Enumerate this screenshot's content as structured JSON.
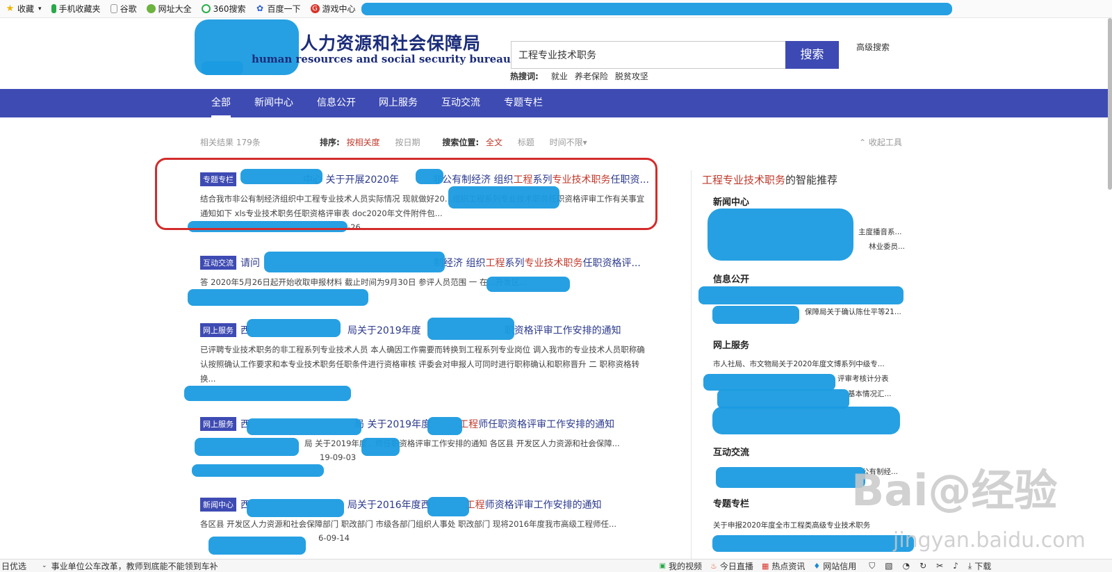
{
  "bookmarks": [
    "收藏",
    "手机收藏夹",
    "谷歌",
    "网址大全",
    "360搜索",
    "百度一下",
    "游戏中心"
  ],
  "header": {
    "title": "人力资源和社会保障局",
    "subtitle": "human resources and social security bureau"
  },
  "search": {
    "value": "工程专业技术职务",
    "button": "搜索",
    "advanced": "高级搜索",
    "hot_label": "热搜词:",
    "hot_words": [
      "就业",
      "养老保险",
      "脱贫攻坚"
    ]
  },
  "nav": [
    "全部",
    "新闻中心",
    "信息公开",
    "网上服务",
    "互动交流",
    "专题专栏"
  ],
  "filter": {
    "count": "相关结果 179条",
    "sort_label": "排序:",
    "sort_rel": "按相关度",
    "sort_date": "按日期",
    "pos_label": "搜索位置:",
    "pos_full": "全文",
    "pos_title": "标题",
    "time": "时间不限▾",
    "collapse": "⌃ 收起工具"
  },
  "results": [
    {
      "tag": "专题专栏",
      "title_a": "中心 关于开展2020年",
      "title_b": "非公有制经济 组织",
      "title_c": "工程",
      "title_d": "系列",
      "title_e": "专业技术职务",
      "title_f": "任职资...",
      "snippet": "结合我市非公有制经济组织中工程专业技术人员实际情况 现就做好20…组织工程系列专业技术职务任职资格评审工作有关事宜通知如下 xls专业技术职务任职资格评审表 doc2020年文件附件包...",
      "date": "-26"
    },
    {
      "tag": "互动交流",
      "title_a": "请问",
      "title_b": "制经济 组织",
      "title_c": "工程",
      "title_d": "系列",
      "title_e": "专业技术职务",
      "title_f": "任职资格评...",
      "snippet": "答 2020年5月26日起开始收取申报材料 截止时间为9月30日 参评人员范围 一 在…开发区...",
      "date": ""
    },
    {
      "tag": "网上服务",
      "title_a": "西",
      "title_b": "局关于2019年度",
      "title_c": "",
      "title_d": "",
      "title_e": "",
      "title_f": "职资格评审工作安排的通知",
      "snippet": "已评聘专业技术职务的非工程系列专业技术人员 本人确因工作需要而转换到工程系列专业岗位 调入我市的专业技术人员职称确认按照确认工作要求和本专业技术职务任职条件进行资格审核 评委会对申报人可同时进行职称确认和职称晋升 二 职称资格转换...",
      "date": ""
    },
    {
      "tag": "网上服务",
      "title_a": "西",
      "title_b": "局 关于2019年度",
      "title_c": "工程",
      "title_d": "",
      "title_e": "",
      "title_f": "师任职资格评审工作安排的通知",
      "snippet": "局 关于2019年度…师任职资格评审工作安排的通知 各区县 开发区人力资源和社会保障...",
      "date": "19-09-03"
    },
    {
      "tag": "新闻中心",
      "title_a": "西",
      "title_b": "局关于2016年度西",
      "title_c": "工程",
      "title_d": "",
      "title_e": "",
      "title_f": "师资格评审工作安排的通知",
      "snippet": "各区县 开发区人力资源和社会保障部门 职改部门 市级各部门组织人事处 职改部门 现将2016年度我市高级工程师任...",
      "date": "6-09-14"
    }
  ],
  "side": {
    "title_hl": "工程专业技术职务",
    "title_rest": "的智能推荐",
    "sections": [
      {
        "name": "新闻中心",
        "lines": [
          "主度播音系...",
          "林业委员..."
        ]
      },
      {
        "name": "信息公开",
        "lines": [
          "保障局关于确认陈仕平等21..."
        ]
      },
      {
        "name": "网上服务",
        "lines": [
          "市人社局、市文物局关于2020年度文博系列中级专...",
          "评审考核计分表",
          "基本情况汇..."
        ]
      },
      {
        "name": "互动交流",
        "lines": [
          "公有制经..."
        ]
      },
      {
        "name": "专题专栏",
        "lines": [
          "关于申报2020年度全市工程类高级专业技术职务"
        ]
      }
    ]
  },
  "statusbar": {
    "left": "日优选",
    "news": "事业单位公车改革，教师到底能不能领到车补",
    "items": [
      "我的视频",
      "今日直播",
      "热点资讯",
      "网站信用",
      "下载"
    ]
  },
  "watermark": {
    "main": "Bai@经验",
    "sub": "jingyan.baidu.com"
  }
}
